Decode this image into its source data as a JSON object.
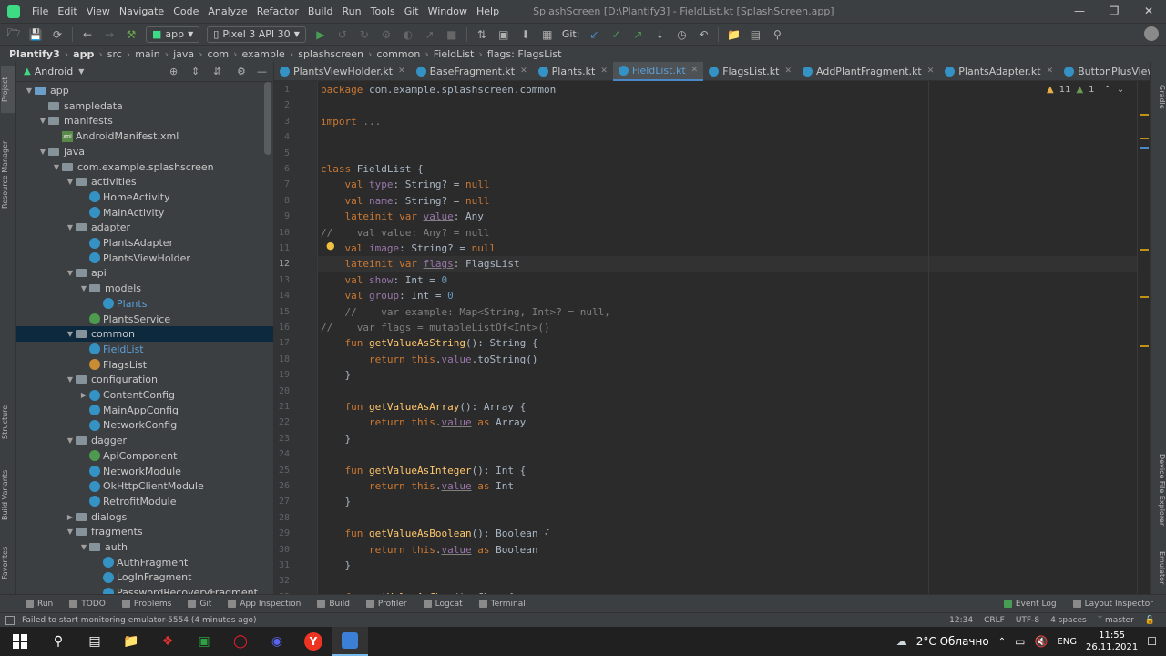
{
  "menu": [
    "File",
    "Edit",
    "View",
    "Navigate",
    "Code",
    "Analyze",
    "Refactor",
    "Build",
    "Run",
    "Tools",
    "Git",
    "Window",
    "Help"
  ],
  "window_title": "SplashScreen [D:\\Plantify3] - FieldList.kt [SplashScreen.app]",
  "toolbar": {
    "run_config": "app",
    "device": "Pixel 3 API 30",
    "git_label": "Git:"
  },
  "breadcrumbs": [
    "Plantify3",
    "app",
    "src",
    "main",
    "java",
    "com",
    "example",
    "splashscreen",
    "common",
    "FieldList",
    "flags: FlagsList"
  ],
  "project_panel": {
    "view_mode": "Android",
    "tree": [
      {
        "label": "app",
        "depth": 0,
        "kind": "folder-blue",
        "arrow": "open"
      },
      {
        "label": "sampledata",
        "depth": 1,
        "kind": "folder",
        "arrow": ""
      },
      {
        "label": "manifests",
        "depth": 1,
        "kind": "folder",
        "arrow": "open"
      },
      {
        "label": "AndroidManifest.xml",
        "depth": 2,
        "kind": "xml",
        "arrow": ""
      },
      {
        "label": "java",
        "depth": 1,
        "kind": "folder",
        "arrow": "open"
      },
      {
        "label": "com.example.splashscreen",
        "depth": 2,
        "kind": "folder",
        "arrow": "open"
      },
      {
        "label": "activities",
        "depth": 3,
        "kind": "folder",
        "arrow": "open"
      },
      {
        "label": "HomeActivity",
        "depth": 4,
        "kind": "class",
        "arrow": ""
      },
      {
        "label": "MainActivity",
        "depth": 4,
        "kind": "class",
        "arrow": ""
      },
      {
        "label": "adapter",
        "depth": 3,
        "kind": "folder",
        "arrow": "open"
      },
      {
        "label": "PlantsAdapter",
        "depth": 4,
        "kind": "class",
        "arrow": ""
      },
      {
        "label": "PlantsViewHolder",
        "depth": 4,
        "kind": "class",
        "arrow": ""
      },
      {
        "label": "api",
        "depth": 3,
        "kind": "folder",
        "arrow": "open"
      },
      {
        "label": "models",
        "depth": 4,
        "kind": "folder",
        "arrow": "open"
      },
      {
        "label": "Plants",
        "depth": 5,
        "kind": "class",
        "arrow": ""
      },
      {
        "label": "PlantsService",
        "depth": 4,
        "kind": "class-green",
        "arrow": ""
      },
      {
        "label": "common",
        "depth": 3,
        "kind": "folder",
        "arrow": "open",
        "selected": true
      },
      {
        "label": "FieldList",
        "depth": 4,
        "kind": "class",
        "arrow": ""
      },
      {
        "label": "FlagsList",
        "depth": 4,
        "kind": "class-orange",
        "arrow": ""
      },
      {
        "label": "configuration",
        "depth": 3,
        "kind": "folder",
        "arrow": "open"
      },
      {
        "label": "ContentConfig",
        "depth": 4,
        "kind": "class",
        "arrow": "closed"
      },
      {
        "label": "MainAppConfig",
        "depth": 4,
        "kind": "class",
        "arrow": ""
      },
      {
        "label": "NetworkConfig",
        "depth": 4,
        "kind": "class",
        "arrow": ""
      },
      {
        "label": "dagger",
        "depth": 3,
        "kind": "folder",
        "arrow": "open"
      },
      {
        "label": "ApiComponent",
        "depth": 4,
        "kind": "class-green",
        "arrow": ""
      },
      {
        "label": "NetworkModule",
        "depth": 4,
        "kind": "class",
        "arrow": ""
      },
      {
        "label": "OkHttpClientModule",
        "depth": 4,
        "kind": "class",
        "arrow": ""
      },
      {
        "label": "RetrofitModule",
        "depth": 4,
        "kind": "class",
        "arrow": ""
      },
      {
        "label": "dialogs",
        "depth": 3,
        "kind": "folder",
        "arrow": "closed"
      },
      {
        "label": "fragments",
        "depth": 3,
        "kind": "folder",
        "arrow": "open"
      },
      {
        "label": "auth",
        "depth": 4,
        "kind": "folder",
        "arrow": "open"
      },
      {
        "label": "AuthFragment",
        "depth": 5,
        "kind": "class",
        "arrow": ""
      },
      {
        "label": "LogInFragment",
        "depth": 5,
        "kind": "class",
        "arrow": ""
      },
      {
        "label": "PasswordRecoveryFragment",
        "depth": 5,
        "kind": "class",
        "arrow": ""
      }
    ]
  },
  "left_strip_tabs": [
    "Project",
    "Resource Manager",
    "Structure",
    "Build Variants",
    "Favorites"
  ],
  "right_strip_tabs": [
    "Gradle",
    "Device File Explorer",
    "Emulator"
  ],
  "editor_tabs": [
    {
      "label": "PlantsViewHolder.kt",
      "active": false
    },
    {
      "label": "BaseFragment.kt",
      "active": false
    },
    {
      "label": "Plants.kt",
      "active": false
    },
    {
      "label": "FieldList.kt",
      "active": true
    },
    {
      "label": "FlagsList.kt",
      "active": false
    },
    {
      "label": "AddPlantFragment.kt",
      "active": false
    },
    {
      "label": "PlantsAdapter.kt",
      "active": false
    },
    {
      "label": "ButtonPlusView.kt",
      "active": false
    }
  ],
  "inspections": {
    "warnings": "11",
    "weak_warnings": "1"
  },
  "code_lines": [
    [
      [
        "kw",
        "package "
      ],
      [
        "t",
        "com.example.splashscreen.common"
      ]
    ],
    [],
    [
      [
        "kw",
        "import "
      ],
      [
        "cm",
        "..."
      ]
    ],
    [],
    [],
    [
      [
        "kw",
        "class "
      ],
      [
        "t",
        "FieldList {"
      ]
    ],
    [
      [
        "t",
        "    "
      ],
      [
        "kw",
        "val "
      ],
      [
        "pr",
        "type"
      ],
      [
        "t",
        ": String? = "
      ],
      [
        "kw",
        "null"
      ]
    ],
    [
      [
        "t",
        "    "
      ],
      [
        "kw",
        "val "
      ],
      [
        "pr",
        "name"
      ],
      [
        "t",
        ": String? = "
      ],
      [
        "kw",
        "null"
      ]
    ],
    [
      [
        "t",
        "    "
      ],
      [
        "kw",
        "lateinit var "
      ],
      [
        "pru",
        "value"
      ],
      [
        "t",
        ": Any"
      ]
    ],
    [
      [
        "cm",
        "//    val value: Any? = null"
      ]
    ],
    [
      [
        "t",
        "    "
      ],
      [
        "kw",
        "val "
      ],
      [
        "pr",
        "image"
      ],
      [
        "t",
        ": String? = "
      ],
      [
        "kw",
        "null"
      ]
    ],
    [
      [
        "t",
        "    "
      ],
      [
        "kw",
        "lateinit var "
      ],
      [
        "pru",
        "flags"
      ],
      [
        "t",
        ": FlagsList"
      ]
    ],
    [
      [
        "t",
        "    "
      ],
      [
        "kw",
        "val "
      ],
      [
        "pr",
        "show"
      ],
      [
        "t",
        ": Int = "
      ],
      [
        "nm",
        "0"
      ]
    ],
    [
      [
        "t",
        "    "
      ],
      [
        "kw",
        "val "
      ],
      [
        "pr",
        "group"
      ],
      [
        "t",
        ": Int = "
      ],
      [
        "nm",
        "0"
      ]
    ],
    [
      [
        "t",
        "    "
      ],
      [
        "cm",
        "//    var example: Map<String, Int>? = null,"
      ]
    ],
    [
      [
        "cm",
        "//    var flags = mutableListOf<Int>()"
      ]
    ],
    [
      [
        "t",
        "    "
      ],
      [
        "kw",
        "fun "
      ],
      [
        "fn",
        "getValueAsString"
      ],
      [
        "t",
        "(): String {"
      ]
    ],
    [
      [
        "t",
        "        "
      ],
      [
        "kw",
        "return this"
      ],
      [
        "t",
        "."
      ],
      [
        "pru",
        "value"
      ],
      [
        "t",
        ".toString()"
      ]
    ],
    [
      [
        "t",
        "    }"
      ]
    ],
    [],
    [
      [
        "t",
        "    "
      ],
      [
        "kw",
        "fun "
      ],
      [
        "fn",
        "getValueAsArray"
      ],
      [
        "t",
        "(): Array {"
      ]
    ],
    [
      [
        "t",
        "        "
      ],
      [
        "kw",
        "return this"
      ],
      [
        "t",
        "."
      ],
      [
        "pru",
        "value"
      ],
      [
        "kw",
        " as "
      ],
      [
        "t",
        "Array"
      ]
    ],
    [
      [
        "t",
        "    }"
      ]
    ],
    [],
    [
      [
        "t",
        "    "
      ],
      [
        "kw",
        "fun "
      ],
      [
        "fn",
        "getValueAsInteger"
      ],
      [
        "t",
        "(): Int {"
      ]
    ],
    [
      [
        "t",
        "        "
      ],
      [
        "kw",
        "return this"
      ],
      [
        "t",
        "."
      ],
      [
        "pru",
        "value"
      ],
      [
        "kw",
        " as "
      ],
      [
        "t",
        "Int"
      ]
    ],
    [
      [
        "t",
        "    }"
      ]
    ],
    [],
    [
      [
        "t",
        "    "
      ],
      [
        "kw",
        "fun "
      ],
      [
        "fn",
        "getValueAsBoolean"
      ],
      [
        "t",
        "(): Boolean {"
      ]
    ],
    [
      [
        "t",
        "        "
      ],
      [
        "kw",
        "return this"
      ],
      [
        "t",
        "."
      ],
      [
        "pru",
        "value"
      ],
      [
        "kw",
        " as "
      ],
      [
        "t",
        "Boolean"
      ]
    ],
    [
      [
        "t",
        "    }"
      ]
    ],
    [],
    [
      [
        "t",
        "    "
      ],
      [
        "kw",
        "fun "
      ],
      [
        "fn",
        "getValueAsChar"
      ],
      [
        "t",
        "(): Char {"
      ]
    ]
  ],
  "current_line": 12,
  "bottom_tabs": [
    "Run",
    "TODO",
    "Problems",
    "Git",
    "App Inspection",
    "Build",
    "Profiler",
    "Logcat",
    "Terminal"
  ],
  "bottom_right_tabs": [
    "Event Log",
    "Layout Inspector"
  ],
  "status": {
    "message": "Failed to start monitoring emulator-5554 (4 minutes ago)",
    "position": "12:34",
    "line_sep": "CRLF",
    "encoding": "UTF-8",
    "indent": "4 spaces",
    "branch": "master"
  },
  "taskbar": {
    "weather": "2°C  Облачно",
    "lang": "ENG",
    "time": "11:55",
    "date": "26.11.2021"
  },
  "colors": {
    "accent": "#4a88c7",
    "selection": "#0d293e",
    "keyword": "#cc7832"
  }
}
